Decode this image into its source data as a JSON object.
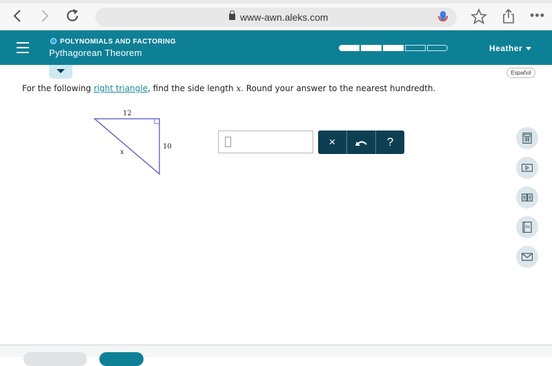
{
  "browser": {
    "url": "www-awn.aleks.com",
    "back_icon": "chevron-left",
    "forward_icon": "chevron-right",
    "reload_icon": "reload",
    "bookmark_icon": "star",
    "share_icon": "share",
    "more_icon": "ellipsis",
    "more_glyph": "•••"
  },
  "header": {
    "topic": "POLYNOMIALS AND FACTORING",
    "lesson": "Pythagorean Theorem",
    "progress": {
      "filled": 3,
      "total": 5
    },
    "user": "Heather",
    "brand_color": "#0e8096"
  },
  "language_button": "Español",
  "question": {
    "prefix": "For the following ",
    "link": "right triangle",
    "middle": ", find the side length ",
    "variable": "x",
    "suffix": ". Round your answer to the nearest hundredth."
  },
  "triangle": {
    "top_side": "12",
    "right_side": "10",
    "hypotenuse": "x",
    "stroke_color": "#6a6ad0"
  },
  "answer": {
    "value": "",
    "clear_label": "×",
    "undo_label": "↶",
    "help_label": "?"
  },
  "tools": [
    {
      "name": "calculator"
    },
    {
      "name": "video"
    },
    {
      "name": "textbook"
    },
    {
      "name": "dictionary"
    },
    {
      "name": "message"
    }
  ]
}
